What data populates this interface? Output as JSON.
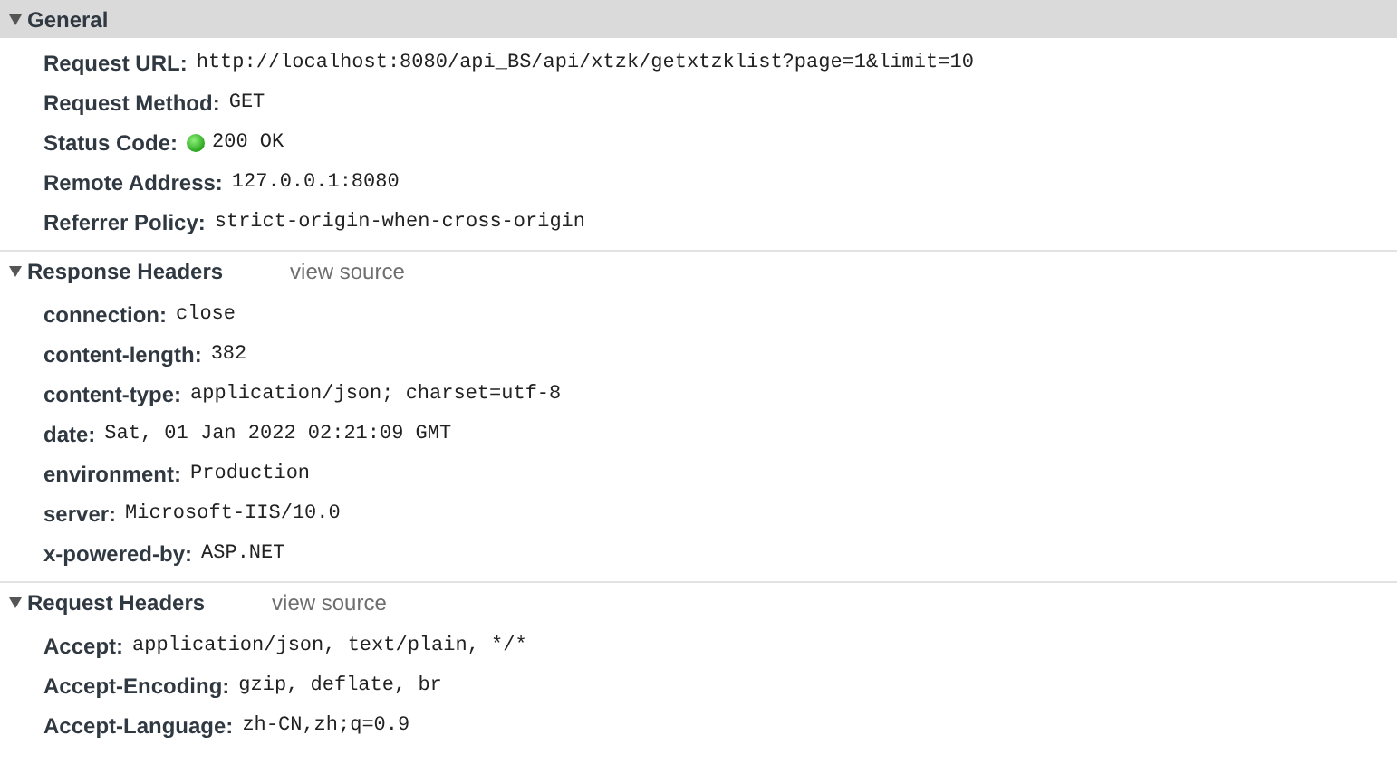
{
  "sections": [
    {
      "title": "General",
      "expanded": true,
      "selected": true,
      "rows": [
        {
          "kind": "plain",
          "name": "Request URL:",
          "value": "http://localhost:8080/api_BS/api/xtzk/getxtzklist?page=1&limit=10"
        },
        {
          "kind": "plain",
          "name": "Request Method:",
          "value": "GET"
        },
        {
          "kind": "status",
          "name": "Status Code:",
          "value": "200 OK"
        },
        {
          "kind": "plain",
          "name": "Remote Address:",
          "value": "127.0.0.1:8080"
        },
        {
          "kind": "plain",
          "name": "Referrer Policy:",
          "value": "strict-origin-when-cross-origin"
        }
      ]
    },
    {
      "title": "Response Headers",
      "link": "view source",
      "expanded": true,
      "selected": false,
      "rows": [
        {
          "kind": "plain",
          "name": "connection:",
          "value": "close"
        },
        {
          "kind": "plain",
          "name": "content-length:",
          "value": "382"
        },
        {
          "kind": "plain",
          "name": "content-type:",
          "value": "application/json; charset=utf-8"
        },
        {
          "kind": "plain",
          "name": "date:",
          "value": "Sat, 01 Jan 2022 02:21:09 GMT"
        },
        {
          "kind": "plain",
          "name": "environment:",
          "value": "Production"
        },
        {
          "kind": "plain",
          "name": "server:",
          "value": "Microsoft-IIS/10.0"
        },
        {
          "kind": "plain",
          "name": "x-powered-by:",
          "value": "ASP.NET"
        }
      ]
    },
    {
      "title": "Request Headers",
      "link": "view source",
      "expanded": true,
      "selected": false,
      "rows": [
        {
          "kind": "plain",
          "name": "Accept:",
          "value": "application/json, text/plain, */*"
        },
        {
          "kind": "plain",
          "name": "Accept-Encoding:",
          "value": "gzip, deflate, br"
        },
        {
          "kind": "plain",
          "name": "Accept-Language:",
          "value": "zh-CN,zh;q=0.9"
        }
      ]
    }
  ]
}
